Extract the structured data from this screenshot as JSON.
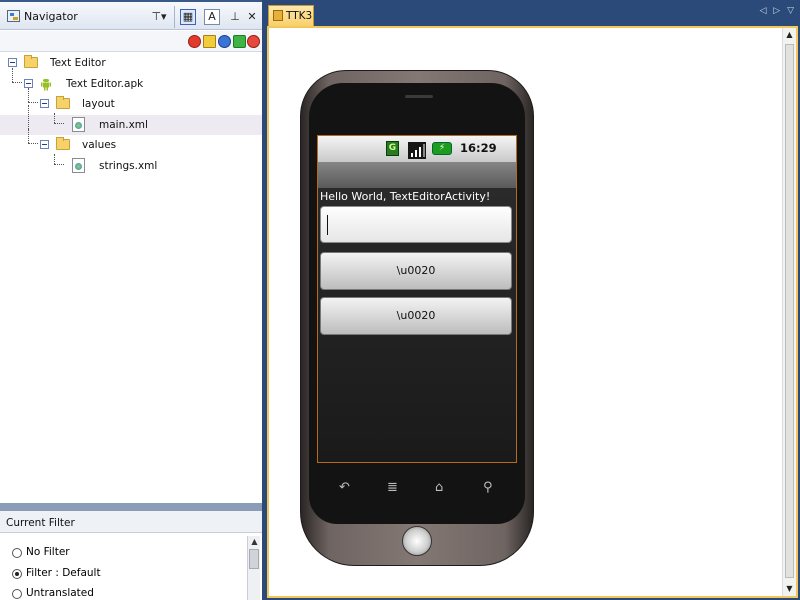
{
  "navigator": {
    "title": "Navigator",
    "tree": [
      {
        "label": "Text Editor",
        "kind": "folder",
        "depth": 0
      },
      {
        "label": "Text Editor.apk",
        "kind": "android-app",
        "depth": 1
      },
      {
        "label": "layout",
        "kind": "folder",
        "depth": 2
      },
      {
        "label": "main.xml",
        "kind": "xml-file",
        "depth": 3,
        "selected": true
      },
      {
        "label": "values",
        "kind": "folder",
        "depth": 2
      },
      {
        "label": "strings.xml",
        "kind": "xml-file",
        "depth": 3
      }
    ],
    "toolbar_icons": [
      "pin-dropdown-icon",
      "list-view-icon",
      "text-view-icon",
      "pin-icon",
      "close-icon"
    ],
    "filter_buttons": [
      "stop-icon",
      "note-icon",
      "info-icon",
      "green-arrow-icon",
      "red-circle-icon"
    ]
  },
  "filter": {
    "title": "Current Filter",
    "options": [
      {
        "label": "No Filter",
        "checked": false
      },
      {
        "label": "Filter : Default",
        "checked": true
      },
      {
        "label": "Untranslated",
        "checked": false
      }
    ]
  },
  "editor": {
    "tab_label": "TTK3"
  },
  "device": {
    "status_time": "16:29",
    "network_label": "G",
    "hello_text": "Hello World, TextEditorActivity!",
    "edit_text_value": "",
    "button1_label": "\\u0020",
    "button2_label": "\\u0020",
    "nav_icons": [
      "back-icon",
      "menu-icon",
      "home-icon",
      "search-icon"
    ]
  },
  "colors": {
    "accent_tab": "#f8d06b",
    "screen_border": "#b86a14",
    "selection": "#eeeaf2",
    "chrome": "#2b4a7a"
  }
}
